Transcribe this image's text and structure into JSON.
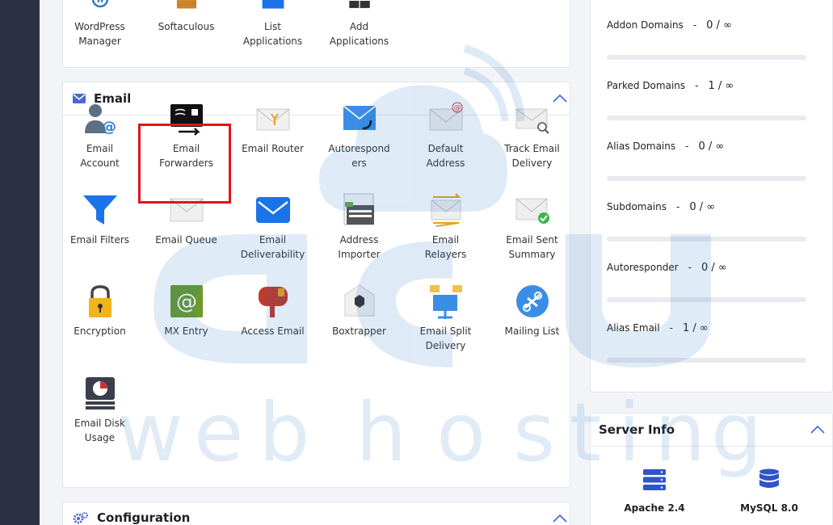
{
  "top_apps": [
    {
      "name": "wordpress-manager",
      "label": "WordPress\nManager",
      "icon": "wordpress-icon"
    },
    {
      "name": "softaculous",
      "label": "Softaculous",
      "icon": "softaculous-icon"
    },
    {
      "name": "list-applications",
      "label": "List\nApplications",
      "icon": "list-icon"
    },
    {
      "name": "add-applications",
      "label": "Add\nApplications",
      "icon": "grid-icon"
    }
  ],
  "email": {
    "title": "Email",
    "items": [
      {
        "name": "email-account",
        "label": "Email\nAccount"
      },
      {
        "name": "email-forwarders",
        "label": "Email\nForwarders"
      },
      {
        "name": "email-router",
        "label": "Email Router"
      },
      {
        "name": "autoresponders",
        "label": "Autorespond\ners"
      },
      {
        "name": "default-address",
        "label": "Default\nAddress"
      },
      {
        "name": "track-email-delivery",
        "label": "Track Email\nDelivery"
      },
      {
        "name": "email-filters",
        "label": "Email Filters"
      },
      {
        "name": "email-queue",
        "label": "Email Queue"
      },
      {
        "name": "email-deliverability",
        "label": "Email\nDeliverability"
      },
      {
        "name": "address-importer",
        "label": "Address\nImporter"
      },
      {
        "name": "email-relayers",
        "label": "Email\nRelayers"
      },
      {
        "name": "email-sent-summary",
        "label": "Email Sent\nSummary"
      },
      {
        "name": "encryption",
        "label": "Encryption"
      },
      {
        "name": "mx-entry",
        "label": "MX Entry"
      },
      {
        "name": "access-email",
        "label": "Access Email"
      },
      {
        "name": "boxtrapper",
        "label": "Boxtrapper"
      },
      {
        "name": "email-split-delivery",
        "label": "Email Split\nDelivery"
      },
      {
        "name": "mailing-list",
        "label": "Mailing List"
      },
      {
        "name": "email-disk-usage",
        "label": "Email Disk\nUsage"
      }
    ]
  },
  "configuration": {
    "title": "Configuration"
  },
  "stats": [
    {
      "label": "Addon Domains",
      "sep": "-",
      "value": "0 / ∞",
      "progress": 0
    },
    {
      "label": "Parked Domains",
      "sep": "-",
      "value": "1 / ∞",
      "progress": 0
    },
    {
      "label": "Alias Domains",
      "sep": "-",
      "value": "0 / ∞",
      "progress": 0
    },
    {
      "label": "Subdomains",
      "sep": "-",
      "value": "0 / ∞",
      "progress": 0
    },
    {
      "label": "Autoresponder",
      "sep": "-",
      "value": "0 / ∞",
      "progress": 0
    },
    {
      "label": "Alias Email",
      "sep": "-",
      "value": "1 / ∞",
      "progress": 0
    }
  ],
  "server_info": {
    "title": "Server Info",
    "items": [
      {
        "label": "Apache 2.4",
        "icon": "server-icon"
      },
      {
        "label": "MySQL 8.0",
        "icon": "database-icon"
      }
    ]
  },
  "colors": {
    "accent": "#3f66d8",
    "highlight": "#e0141a",
    "sidebar": "#2c3145"
  }
}
